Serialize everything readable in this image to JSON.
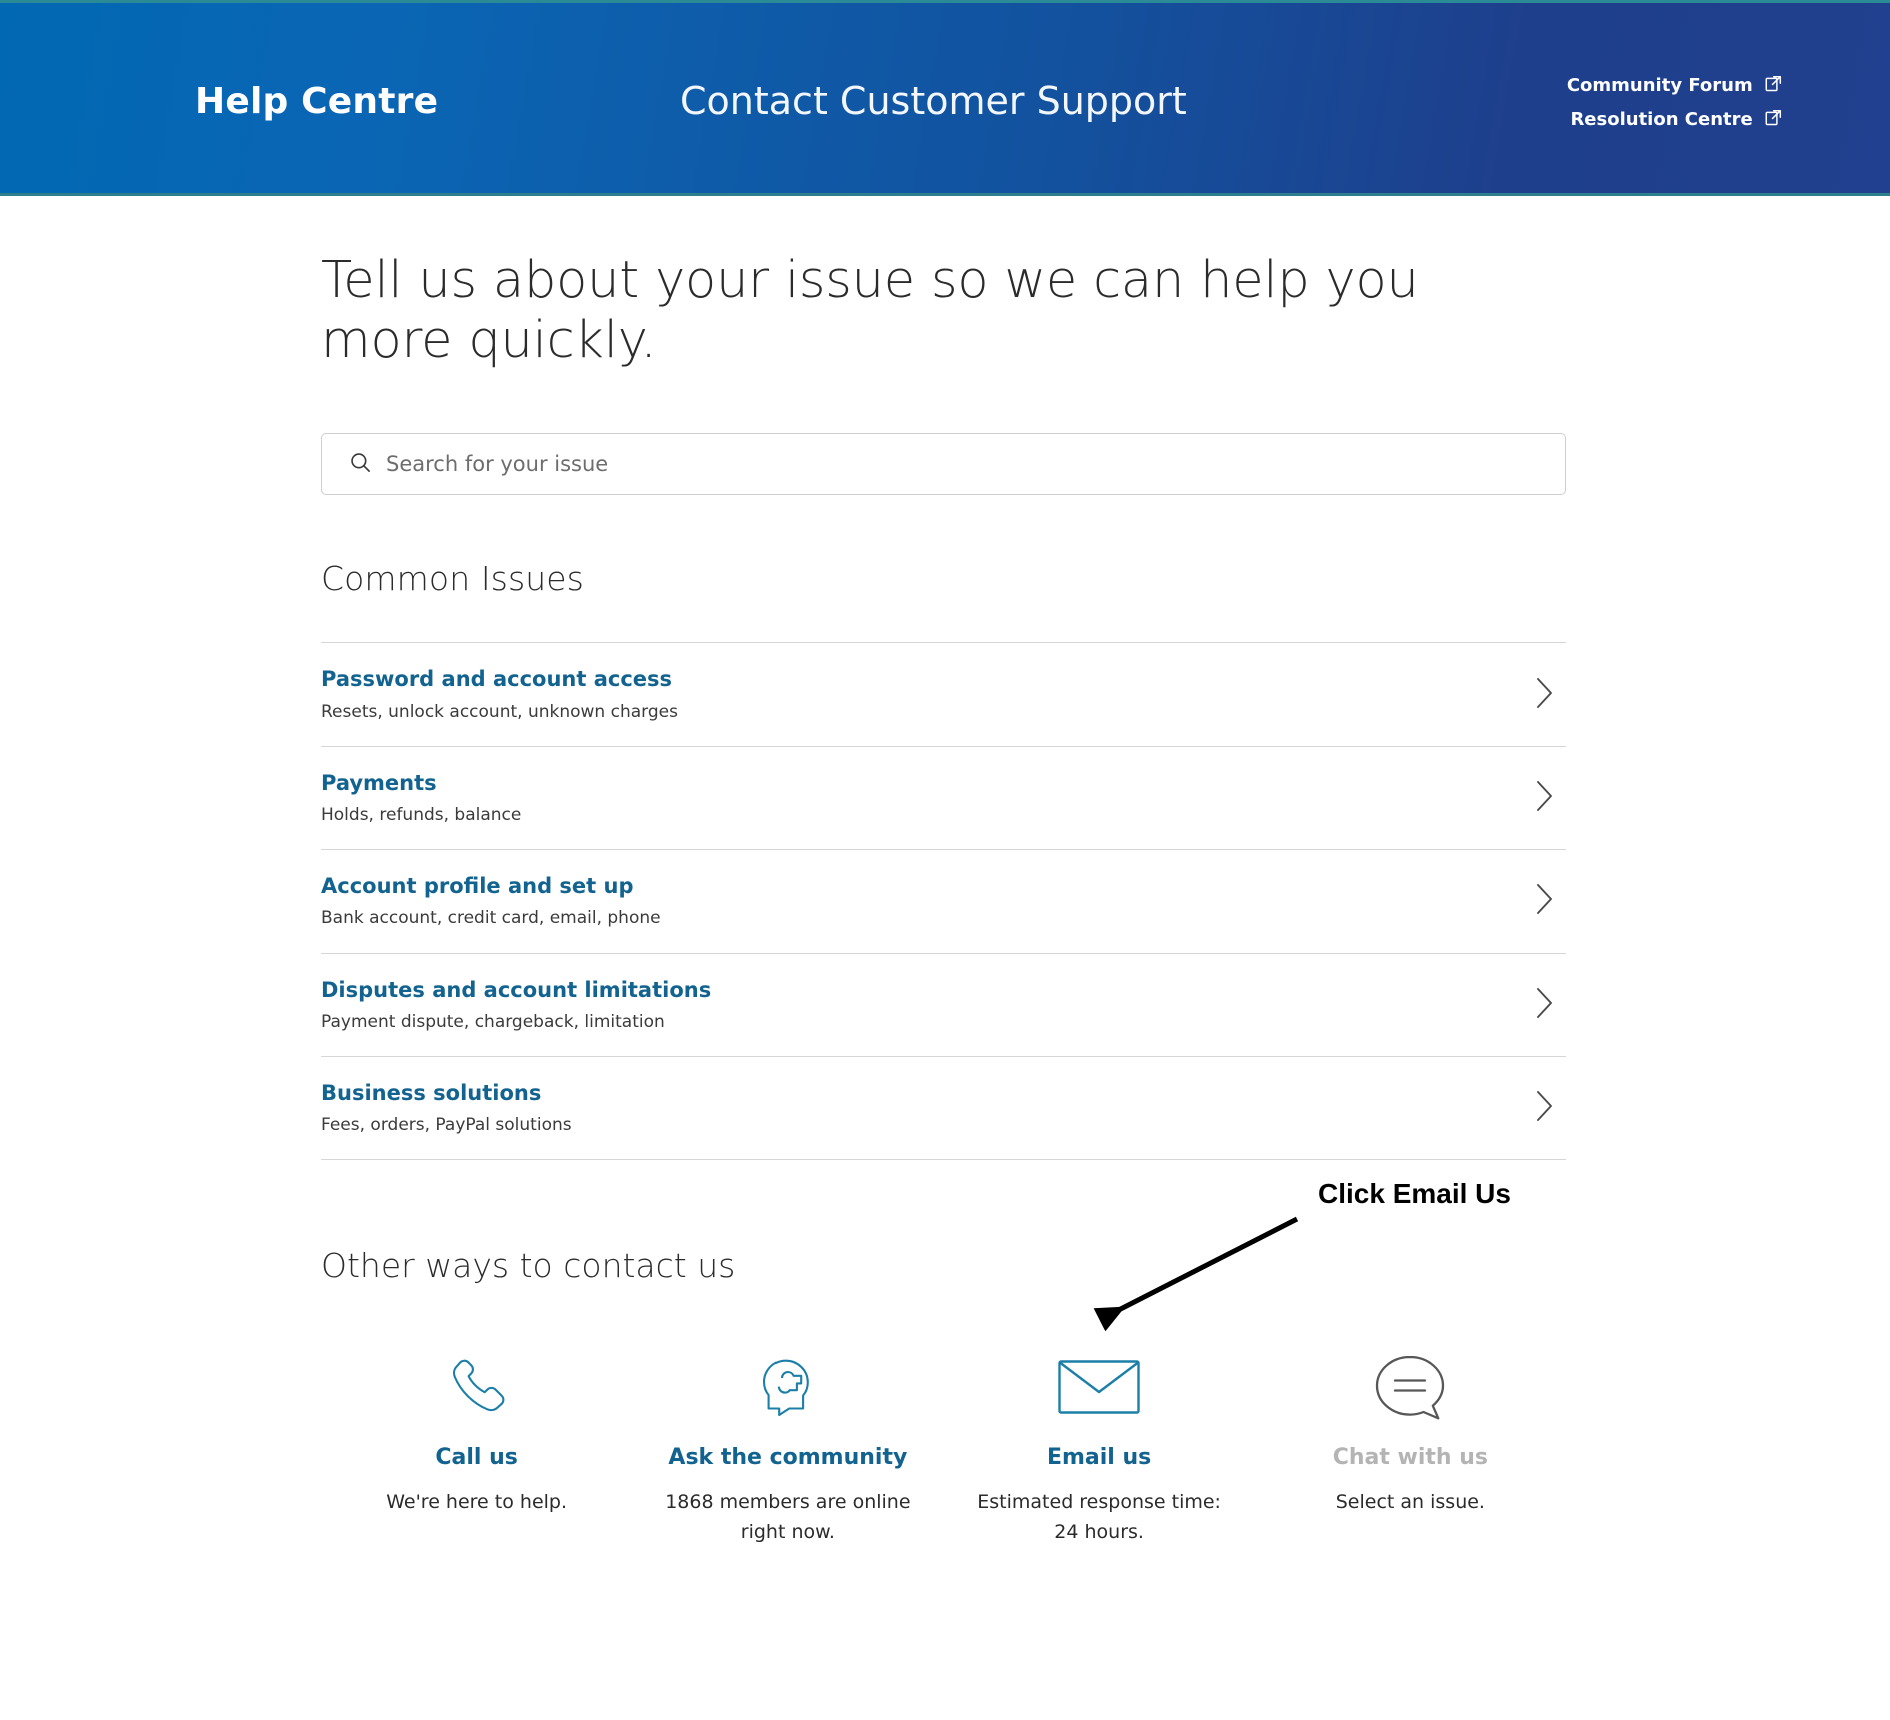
{
  "header": {
    "brand": "Help Centre",
    "page_title": "Contact Customer Support",
    "links": [
      {
        "label": "Community Forum",
        "icon": "external-link-icon"
      },
      {
        "label": "Resolution Centre",
        "icon": "external-link-icon"
      }
    ],
    "gradient_from": "#0168b3",
    "gradient_to": "#21408f",
    "accent_rule": "#2a8a95"
  },
  "main": {
    "hero": "Tell us about your issue so we can help you more quickly.",
    "search": {
      "placeholder": "Search for your issue",
      "value": "",
      "icon": "search-icon"
    },
    "common_issues_title": "Common Issues",
    "issues": [
      {
        "title": "Password and account access",
        "subtitle": "Resets, unlock account, unknown charges",
        "chevron": "chevron-right-icon"
      },
      {
        "title": "Payments",
        "subtitle": "Holds, refunds, balance",
        "chevron": "chevron-right-icon"
      },
      {
        "title": "Account profile and set up",
        "subtitle": "Bank account, credit card, email, phone",
        "chevron": "chevron-right-icon"
      },
      {
        "title": "Disputes and account limitations",
        "subtitle": "Payment dispute, chargeback, limitation",
        "chevron": "chevron-right-icon"
      },
      {
        "title": "Business solutions",
        "subtitle": "Fees, orders, PayPal solutions",
        "chevron": "chevron-right-icon"
      }
    ],
    "other_ways_title": "Other ways to contact us",
    "contact_options": [
      {
        "label": "Call us",
        "description": "We're here to help.",
        "icon": "phone-icon",
        "disabled": false
      },
      {
        "label": "Ask the community",
        "description": "1868 members are online right now.",
        "icon": "community-head-icon",
        "disabled": false
      },
      {
        "label": "Email us",
        "description": "Estimated response time: 24 hours.",
        "icon": "envelope-icon",
        "disabled": false
      },
      {
        "label": "Chat with us",
        "description": "Select an issue.",
        "icon": "chat-bubble-icon",
        "disabled": true
      }
    ]
  },
  "annotation": {
    "text": "Click Email Us",
    "arrow": "arrow-pointing-to-email-us",
    "color": "#000000"
  },
  "colors": {
    "link_blue": "#12638f",
    "icon_teal": "#1c7fa8",
    "text_dark": "#2b2b2b",
    "disabled_grey": "#b4b4b4",
    "rule_grey": "#d6d6d6"
  }
}
